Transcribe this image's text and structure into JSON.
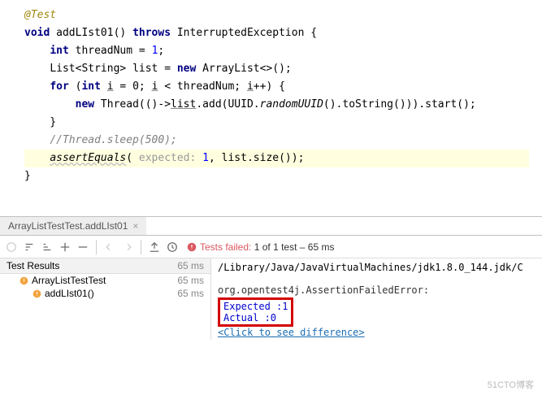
{
  "code": {
    "annotation": "@Test",
    "fn_kw": "void",
    "fn_name": "addLIst01()",
    "throws_kw": "throws",
    "exception": "InterruptedException",
    "int_kw": "int",
    "var_threadNum": "threadNum",
    "eq": " = ",
    "one": "1",
    "semic": ";",
    "list_decl_a": "List<String> ",
    "list_var": "list",
    "new_kw": "new",
    "arraylist": " ArrayList<>()",
    "for_kw": "for",
    "for_init_a": " (",
    "int_kw2": "int",
    "i_var": "i",
    "for_cond": " = 0; ",
    "i_lt": " < threadNum; ",
    "i_inc": "++",
    "for_close": ") {",
    "thread_new": "new",
    "thread_line": " Thread(()->",
    "list_add": "list",
    "dot_add": ".add(UUID.",
    "randomUUID": "randomUUID",
    "rest": "().toString())).start();",
    "comment": "//Thread.sleep(500);",
    "assert_call": "assertEquals",
    "assert_open": "( ",
    "expected_hint": "expected: ",
    "expected_val": "1",
    "assert_rest": ", list.size());"
  },
  "tab": {
    "label": "ArrayListTestTest.addLIst01"
  },
  "toolbar": {
    "status_prefix": "Tests failed:",
    "status_count": " 1",
    "status_of": " of 1 test – ",
    "status_time": "65 ms"
  },
  "tree": {
    "header": "Test Results",
    "header_time": "65 ms",
    "node1": "ArrayListTestTest",
    "node1_time": "65 ms",
    "node2": "addLIst01()",
    "node2_time": "65 ms"
  },
  "output": {
    "path": "/Library/Java/JavaVirtualMachines/jdk1.8.0_144.jdk/C",
    "error": "org.opentest4j.AssertionFailedError:",
    "expected": "Expected :1",
    "actual": "Actual   :0",
    "link": "<Click to see difference>"
  },
  "watermark": "51CTO博客"
}
